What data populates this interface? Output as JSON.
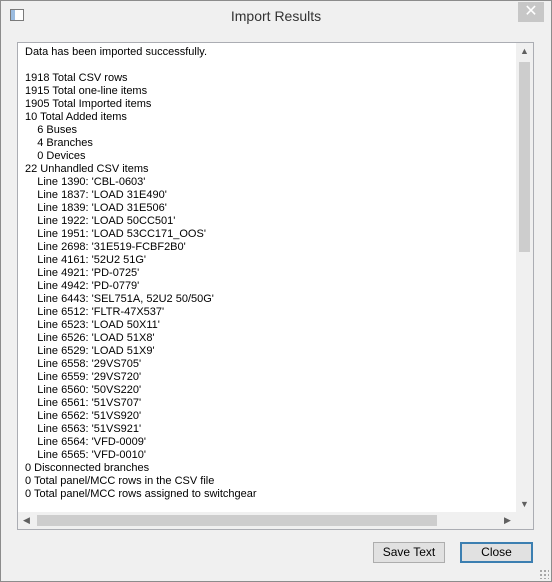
{
  "window": {
    "title": "Import Results",
    "close_glyph": "✕"
  },
  "results": {
    "lines": [
      "Data has been imported successfully.",
      "",
      "1918 Total CSV rows",
      "1915 Total one-line items",
      "1905 Total Imported items",
      "10 Total Added items",
      "    6 Buses",
      "    4 Branches",
      "    0 Devices",
      "22 Unhandled CSV items",
      "    Line 1390: 'CBL-0603'",
      "    Line 1837: 'LOAD 31E490'",
      "    Line 1839: 'LOAD 31E506'",
      "    Line 1922: 'LOAD 50CC501'",
      "    Line 1951: 'LOAD 53CC171_OOS'",
      "    Line 2698: '31E519-FCBF2B0'",
      "    Line 4161: '52U2 51G'",
      "    Line 4921: 'PD-0725'",
      "    Line 4942: 'PD-0779'",
      "    Line 6443: 'SEL751A, 52U2 50/50G'",
      "    Line 6512: 'FLTR-47X537'",
      "    Line 6523: 'LOAD 50X11'",
      "    Line 6526: 'LOAD 51X8'",
      "    Line 6529: 'LOAD 51X9'",
      "    Line 6558: '29VS705'",
      "    Line 6559: '29VS720'",
      "    Line 6560: '50VS220'",
      "    Line 6561: '51VS707'",
      "    Line 6562: '51VS920'",
      "    Line 6563: '51VS921'",
      "    Line 6564: 'VFD-0009'",
      "    Line 6565: 'VFD-0010'",
      "0 Disconnected branches",
      "0 Total panel/MCC rows in the CSV file",
      "0 Total panel/MCC rows assigned to switchgear"
    ]
  },
  "scrollbar": {
    "up_glyph": "▲",
    "down_glyph": "▼",
    "left_glyph": "◀",
    "right_glyph": "▶"
  },
  "buttons": {
    "save_text": "Save Text",
    "close": "Close"
  }
}
